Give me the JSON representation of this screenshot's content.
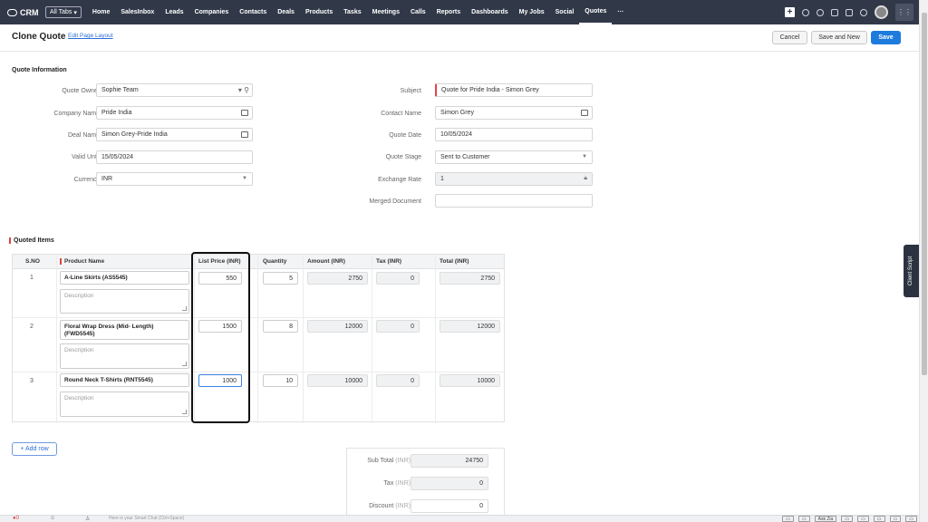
{
  "nav": {
    "brand": "CRM",
    "all_tabs": "All Tabs",
    "items": [
      "Home",
      "SalesInbox",
      "Leads",
      "Companies",
      "Contacts",
      "Deals",
      "Products",
      "Tasks",
      "Meetings",
      "Calls",
      "Reports",
      "Dashboards",
      "My Jobs",
      "Social",
      "Quotes",
      "···"
    ],
    "active": "Quotes"
  },
  "header": {
    "title": "Clone Quote",
    "edit_layout": "Edit Page Layout",
    "cancel": "Cancel",
    "save_new": "Save and New",
    "save": "Save"
  },
  "quote_info": {
    "section_title": "Quote Information",
    "quote_owner_label": "Quote Owner",
    "quote_owner": "Sophie Team",
    "company_label": "Company Name",
    "company": "Pride India",
    "deal_label": "Deal Name",
    "deal": "Simon Grey-Pride India",
    "valid_until_label": "Valid Until",
    "valid_until": "15/05/2024",
    "currency_label": "Currency",
    "currency": "INR",
    "subject_label": "Subject",
    "subject": "Quote for Pride India - Simon Grey",
    "contact_label": "Contact Name",
    "contact": "Simon Grey",
    "quote_date_label": "Quote Date",
    "quote_date": "10/05/2024",
    "quote_stage_label": "Quote Stage",
    "quote_stage": "Sent to Customer",
    "exchange_rate_label": "Exchange Rate",
    "exchange_rate": "1",
    "merged_doc_label": "Merged Document",
    "merged_doc": ""
  },
  "items": {
    "section_title": "Quoted Items",
    "headers": {
      "sno": "S.NO",
      "product": "Product Name",
      "list_price": "List Price (INR)",
      "quantity": "Quantity",
      "amount": "Amount (INR)",
      "tax": "Tax (INR)",
      "total": "Total (INR)"
    },
    "description_placeholder": "Description",
    "rows": [
      {
        "sno": "1",
        "product": "A-Line Skirts (AS5545)",
        "list_price": "550",
        "quantity": "5",
        "amount": "2750",
        "tax": "0",
        "total": "2750"
      },
      {
        "sno": "2",
        "product": "Floral Wrap Dress (Mid- Length) (FWD5545)",
        "list_price": "1500",
        "quantity": "8",
        "amount": "12000",
        "tax": "0",
        "total": "12000"
      },
      {
        "sno": "3",
        "product": "Round Neck T-Shirts (RNT5545)",
        "list_price": "1000",
        "quantity": "10",
        "amount": "10000",
        "tax": "0",
        "total": "10000"
      }
    ],
    "add_row": "+ Add row"
  },
  "totals": {
    "subtotal_label": "Sub Total",
    "subtotal": "24750",
    "tax_label": "Tax",
    "tax": "0",
    "discount_label": "Discount",
    "discount": "0",
    "unit": "(INR)"
  },
  "sidebar": {
    "client_script": "Client Script"
  },
  "bottom": {
    "smart_chat": "Here is your Smart Chat (Ctrl+Space)",
    "ask_zia": "Ask Zia"
  }
}
